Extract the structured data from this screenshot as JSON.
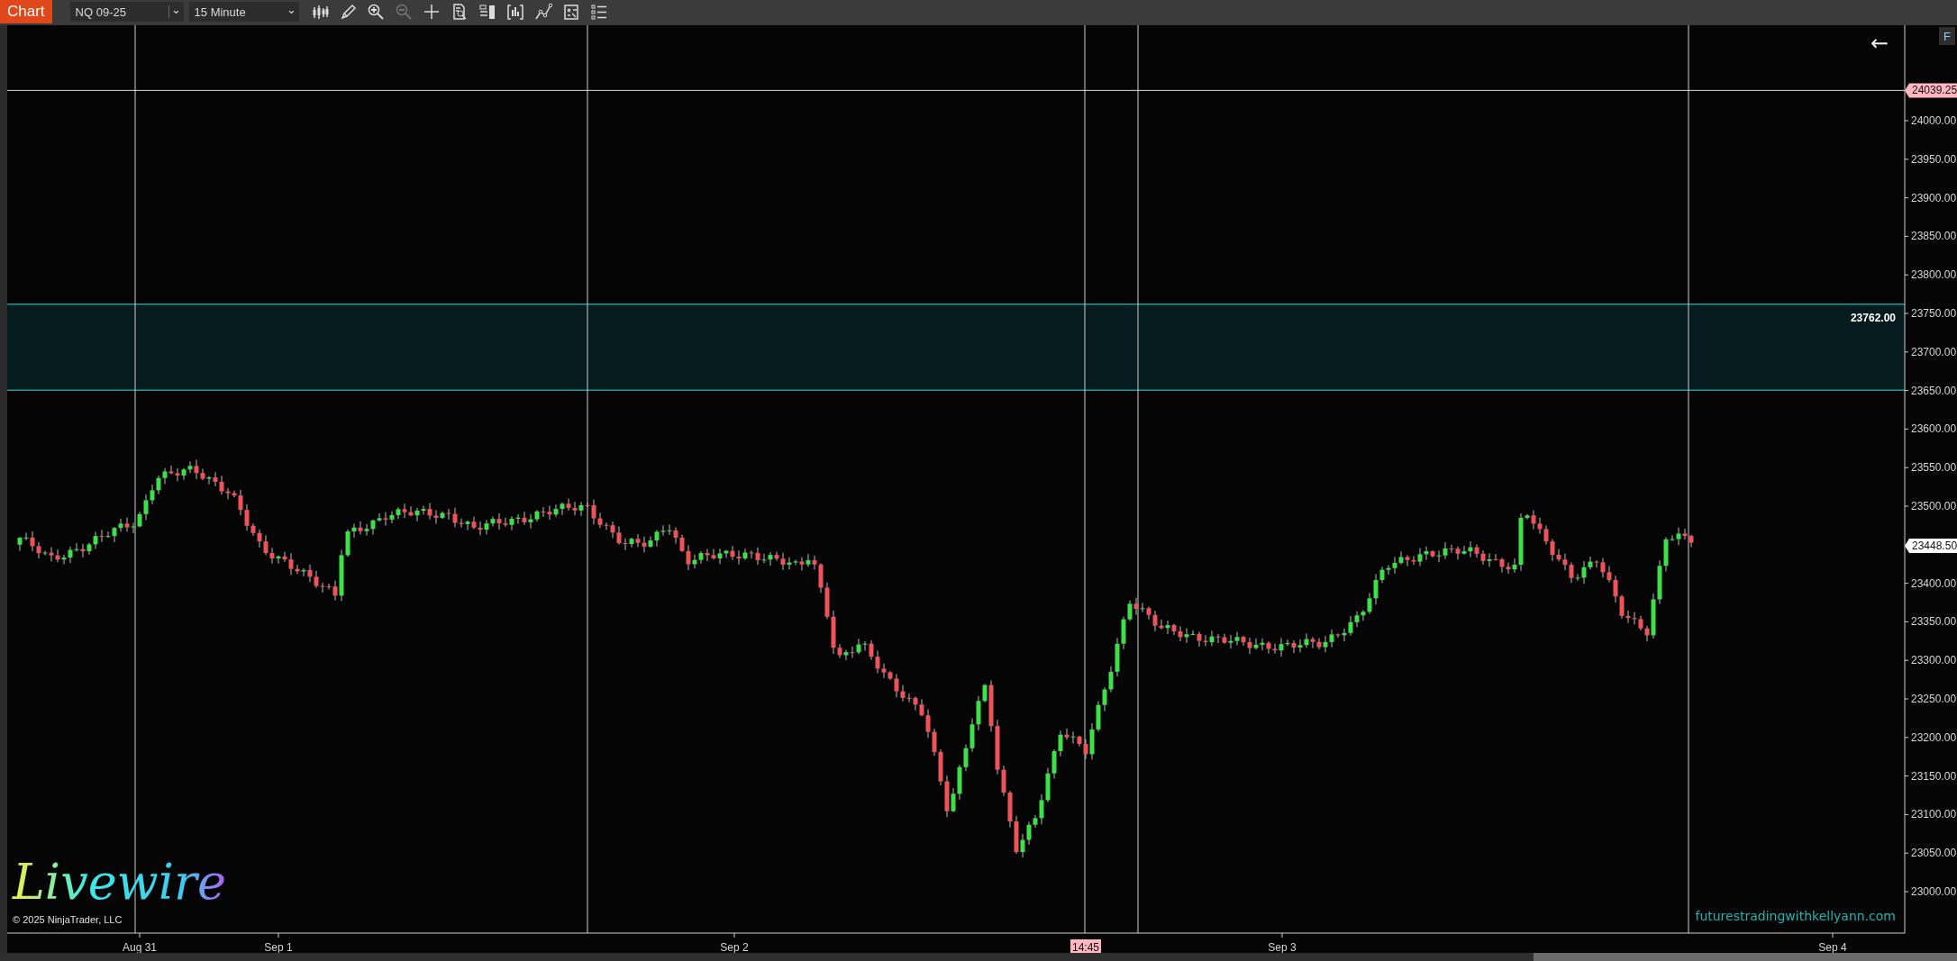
{
  "toolbar": {
    "chart_button": "Chart",
    "instrument": {
      "value": "NQ 09-25",
      "caret": "⌄"
    },
    "interval": {
      "value": "15 Minute",
      "caret": "⌄"
    },
    "tools": [
      {
        "kind": "bars",
        "disabled": false
      },
      {
        "kind": "pencil",
        "disabled": false
      },
      {
        "kind": "zoom-in",
        "disabled": false
      },
      {
        "kind": "zoom-out",
        "disabled": true
      },
      {
        "kind": "crosshair",
        "disabled": false
      },
      {
        "kind": "doc-search",
        "disabled": false
      },
      {
        "kind": "panel",
        "disabled": false
      },
      {
        "kind": "chart-frame",
        "disabled": false
      },
      {
        "kind": "line-tool",
        "disabled": false
      },
      {
        "kind": "doc-grid",
        "disabled": false
      },
      {
        "kind": "list",
        "disabled": false
      }
    ]
  },
  "chart": {
    "back_arrow": "←",
    "flat_button": "F",
    "price_axis": {
      "labels": [
        "24000.00",
        "23950.00",
        "23900.00",
        "23850.00",
        "23800.00",
        "23750.00",
        "23700.00",
        "23650.00",
        "23600.00",
        "23550.00",
        "23500.00",
        "23400.00",
        "23350.00",
        "23300.00",
        "23250.00",
        "23200.00",
        "23150.00",
        "23100.00",
        "23050.00",
        "23000.00"
      ]
    },
    "price_markers": [
      {
        "text": "24039.25",
        "kind": "line"
      },
      {
        "text": "23448.50",
        "kind": "last"
      }
    ],
    "zone": {
      "label": "23762.00"
    },
    "time_axis": [
      {
        "text": "Aug 31",
        "kind": "date"
      },
      {
        "text": "Sep 1",
        "kind": "date"
      },
      {
        "text": "Sep 2",
        "kind": "date"
      },
      {
        "text": "14:45",
        "kind": "cursor"
      },
      {
        "text": "Sep 3",
        "kind": "date"
      },
      {
        "text": "Sep 4",
        "kind": "date"
      }
    ],
    "logo": "Livewire",
    "copyright": "© 2025 NinjaTrader, LLC",
    "website": "futurestradingwithkellyann.com"
  }
}
